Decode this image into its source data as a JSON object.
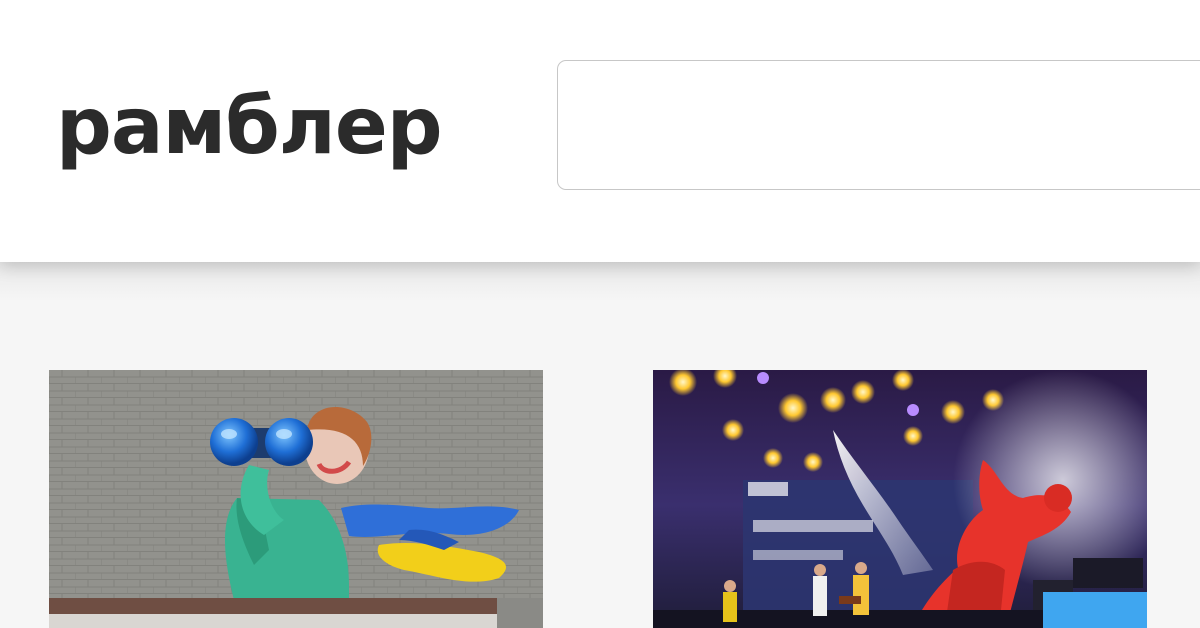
{
  "header": {
    "logo_text": "рамблер",
    "search": {
      "value": "",
      "placeholder": ""
    }
  },
  "feed": {
    "cards": [
      {
        "image": "mural-woman-with-binoculars-image"
      },
      {
        "image": "concert-stage-image"
      }
    ]
  },
  "colors": {
    "header_bg": "#ffffff",
    "page_bg": "#f3f3f3",
    "logo": "#2b2b2b",
    "input_border": "#c7c7c7"
  }
}
